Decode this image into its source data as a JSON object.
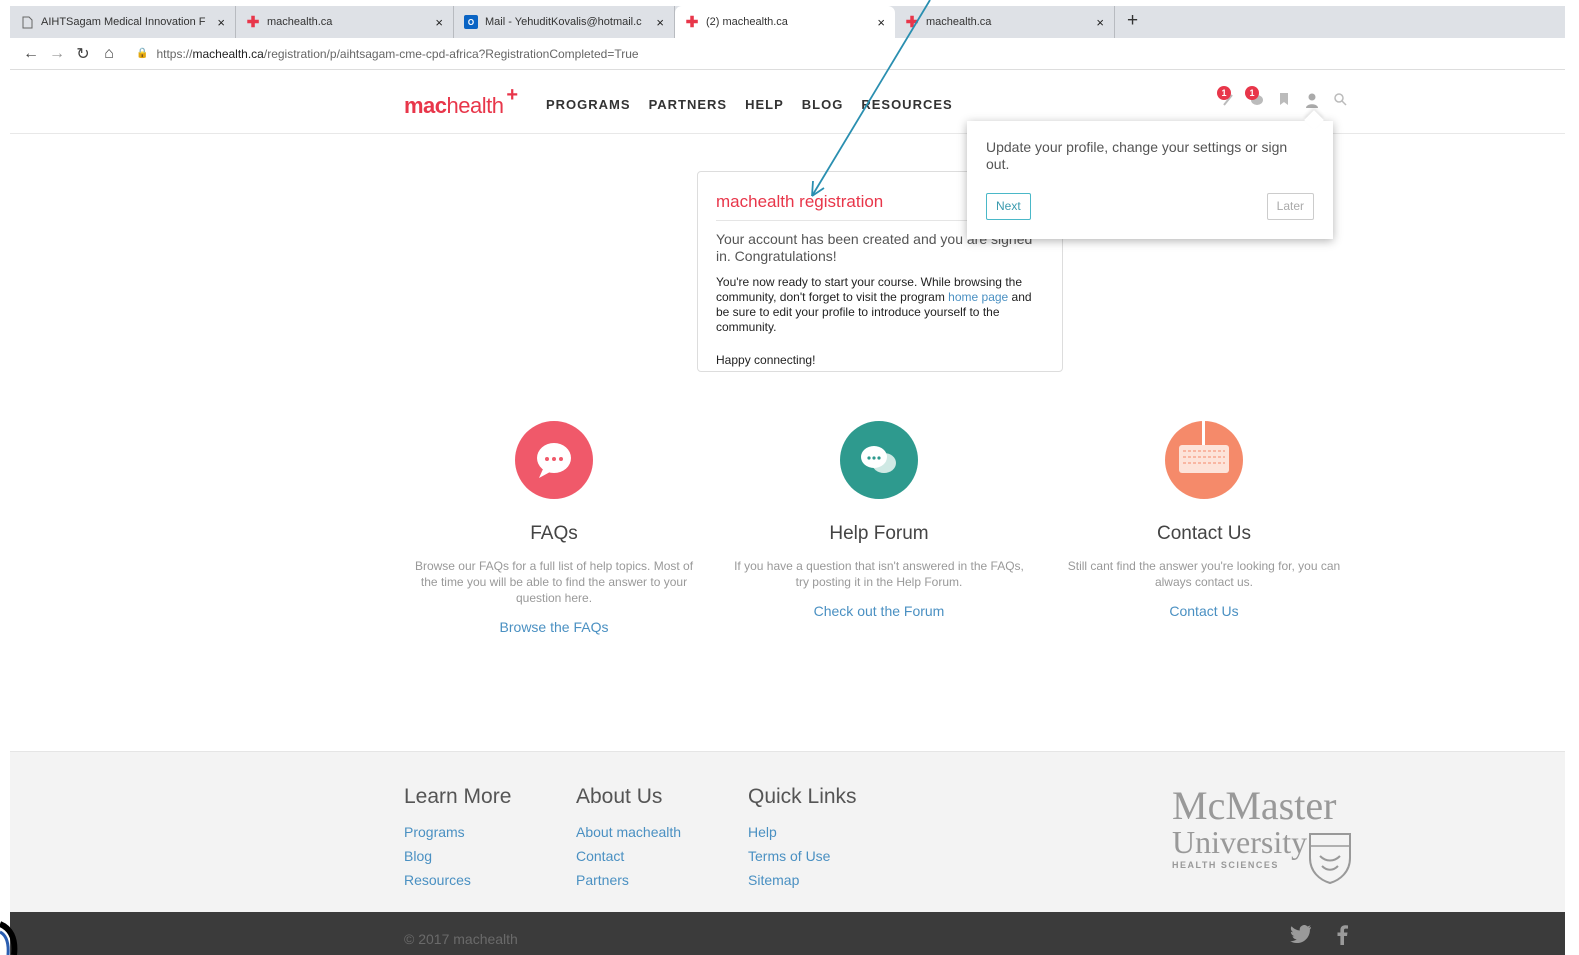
{
  "browser": {
    "tabs": [
      {
        "title": "AIHTSagam Medical Innovation F",
        "icon": "page-icon"
      },
      {
        "title": "machealth.ca",
        "icon": "machealth-icon"
      },
      {
        "title": "Mail - YehuditKovalis@hotmail.c",
        "icon": "outlook-icon"
      },
      {
        "title": "(2) machealth.ca",
        "icon": "machealth-icon",
        "active": true
      },
      {
        "title": "machealth.ca",
        "icon": "machealth-icon"
      }
    ],
    "close_glyph": "×",
    "new_tab_glyph": "+",
    "url_prefix": "https://",
    "url_domain": "machealth.ca",
    "url_path": "/registration/p/aihtsagam-cme-cpd-africa?RegistrationCompleted=True"
  },
  "site": {
    "logo_bold": "mac",
    "logo_rest": "health",
    "logo_plus": "+",
    "nav": [
      "PROGRAMS",
      "PARTNERS",
      "HELP",
      "BLOG",
      "RESOURCES"
    ],
    "notifications_count": "1",
    "messages_count": "1"
  },
  "registration": {
    "title": "machealth registration",
    "message": "Your account has been created and you are signed in. Congratulations!",
    "body_before_link": "You're now ready to start your course. While browsing the community, don't forget to visit the program ",
    "body_link": "home page",
    "body_after_link": " and be sure to edit your profile to introduce yourself to the community.",
    "closing": "Happy connecting!"
  },
  "popover": {
    "text": "Update your profile, change your settings or sign out.",
    "next_label": "Next",
    "later_label": "Later"
  },
  "help": [
    {
      "title": "FAQs",
      "text": "Browse our FAQs for a full list of help topics. Most of the time you will be able to find the answer to your question here.",
      "link": "Browse the FAQs",
      "color": "#f0596a"
    },
    {
      "title": "Help Forum",
      "text": "If you have a question that isn't answered in the FAQs, try posting it in the Help Forum.",
      "link": "Check out the Forum",
      "color": "#2e9a8e"
    },
    {
      "title": "Contact Us",
      "text": "Still cant find the answer you're looking for, you can always contact us.",
      "link": "Contact Us",
      "color": "#f58a6a"
    }
  ],
  "footer": {
    "columns": [
      {
        "heading": "Learn More",
        "links": [
          "Programs",
          "Blog",
          "Resources"
        ]
      },
      {
        "heading": "About Us",
        "links": [
          "About machealth",
          "Contact",
          "Partners"
        ]
      },
      {
        "heading": "Quick Links",
        "links": [
          "Help",
          "Terms of Use",
          "Sitemap"
        ]
      }
    ],
    "logo_line1": "McMaster",
    "logo_line2": "University",
    "logo_line3": "HEALTH SCIENCES",
    "copyright": "© 2017 machealth"
  },
  "colors": {
    "brand": "#e8364a",
    "link": "#4a90c2",
    "annotation_arrow": "#2a8fb0"
  }
}
